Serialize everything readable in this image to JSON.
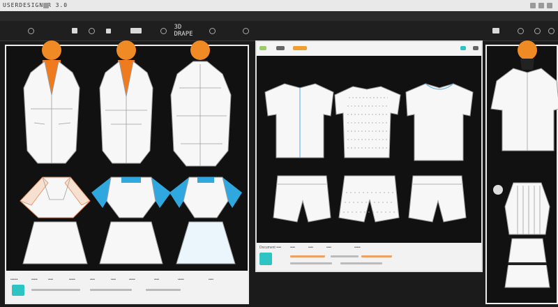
{
  "window": {
    "title": "USERDESIGNER 3.0"
  },
  "toolbar": {
    "view_label": "3D DRAPE"
  },
  "left_panel": {
    "footer_items": [
      "••••••",
      "•••••",
      "••••",
      "•••••",
      "••••",
      "••••",
      "•••••",
      "••••",
      "•••••",
      "••••"
    ]
  },
  "middle_panel": {
    "footer_items": [
      "Document ••••",
      "••••",
      "••••",
      "••••",
      "•••••"
    ]
  },
  "colors": {
    "accent_orange": "#f07a1e",
    "accent_blue": "#2fa8e0",
    "accent_teal": "#2ec4c4",
    "accent_green": "#9ccc65"
  },
  "icons": [
    "settings-icon",
    "search-icon",
    "layers-icon",
    "grid-icon",
    "zoom-icon",
    "user-icon",
    "menu-icon"
  ]
}
